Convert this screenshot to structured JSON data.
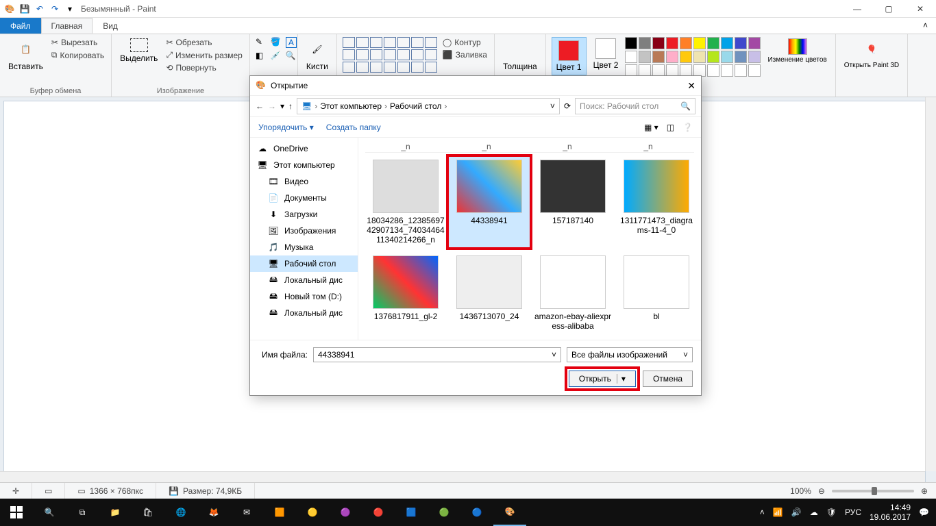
{
  "titlebar": {
    "app_title": "Безымянный - Paint"
  },
  "ribbon_tabs": {
    "file": "Файл",
    "home": "Главная",
    "view": "Вид"
  },
  "ribbon": {
    "paste": "Вставить",
    "cut": "Вырезать",
    "copy": "Копировать",
    "clipboard_group": "Буфер обмена",
    "select": "Выделить",
    "crop": "Обрезать",
    "resize": "Изменить размер",
    "rotate": "Повернуть",
    "image_group": "Изображение",
    "brushes": "Кисти",
    "outline": "Контур",
    "fill": "Заливка",
    "thickness": "Толщина",
    "color1": "Цвет 1",
    "color2": "Цвет 2",
    "edit_colors": "Изменение цветов",
    "open_paint3d": "Открыть Paint 3D"
  },
  "colors": {
    "primary": "#ed1c24",
    "secondary": "#ffffff",
    "row1": [
      "#000000",
      "#7f7f7f",
      "#880015",
      "#ed1c24",
      "#ff7f27",
      "#fff200",
      "#22b14c",
      "#00a2e8",
      "#3f48cc",
      "#a349a4"
    ],
    "row2": [
      "#ffffff",
      "#c3c3c3",
      "#b97a57",
      "#ffaec9",
      "#ffc90e",
      "#efe4b0",
      "#b5e61d",
      "#99d9ea",
      "#7092be",
      "#c8bfe7"
    ],
    "row3": [
      "#ffffff",
      "#ffffff",
      "#ffffff",
      "#ffffff",
      "#ffffff",
      "#ffffff",
      "#ffffff",
      "#ffffff",
      "#ffffff",
      "#ffffff"
    ]
  },
  "dialog": {
    "title": "Открытие",
    "breadcrumb": [
      "Этот компьютер",
      "Рабочий стол"
    ],
    "search_placeholder": "Поиск: Рабочий стол",
    "organize": "Упорядочить",
    "new_folder": "Создать папку",
    "sidebar": [
      {
        "label": "OneDrive",
        "icon": "cloud",
        "sub": false
      },
      {
        "label": "Этот компьютер",
        "icon": "pc",
        "sub": false
      },
      {
        "label": "Видео",
        "icon": "video",
        "sub": true
      },
      {
        "label": "Документы",
        "icon": "doc",
        "sub": true
      },
      {
        "label": "Загрузки",
        "icon": "download",
        "sub": true
      },
      {
        "label": "Изображения",
        "icon": "image",
        "sub": true
      },
      {
        "label": "Музыка",
        "icon": "music",
        "sub": true
      },
      {
        "label": "Рабочий стол",
        "icon": "desktop",
        "sub": true,
        "selected": true
      },
      {
        "label": "Локальный дис",
        "icon": "drive",
        "sub": true
      },
      {
        "label": "Новый том (D:)",
        "icon": "drive",
        "sub": true
      },
      {
        "label": "Локальный дис",
        "icon": "drive",
        "sub": true
      }
    ],
    "column_header": "_n",
    "files": [
      {
        "name": "18034286_1238569742907134_7403446411340214266_n",
        "selected": false
      },
      {
        "name": "44338941",
        "selected": true
      },
      {
        "name": "157187140",
        "selected": false
      },
      {
        "name": "1311771473_diagrams-11-4_0",
        "selected": false
      },
      {
        "name": "1376817911_gl-2",
        "selected": false
      },
      {
        "name": "1436713070_24",
        "selected": false
      },
      {
        "name": "amazon-ebay-aliexpress-alibaba",
        "selected": false
      },
      {
        "name": "bl",
        "selected": false
      }
    ],
    "filename_label": "Имя файла:",
    "filename_value": "44338941",
    "filter": "Все файлы изображений",
    "open_btn": "Открыть",
    "cancel_btn": "Отмена"
  },
  "statusbar": {
    "dimensions": "1366 × 768пкс",
    "size_label": "Размер: 74,9КБ",
    "zoom": "100%"
  },
  "taskbar": {
    "lang": "РУС",
    "time": "14:49",
    "date": "19.06.2017"
  }
}
